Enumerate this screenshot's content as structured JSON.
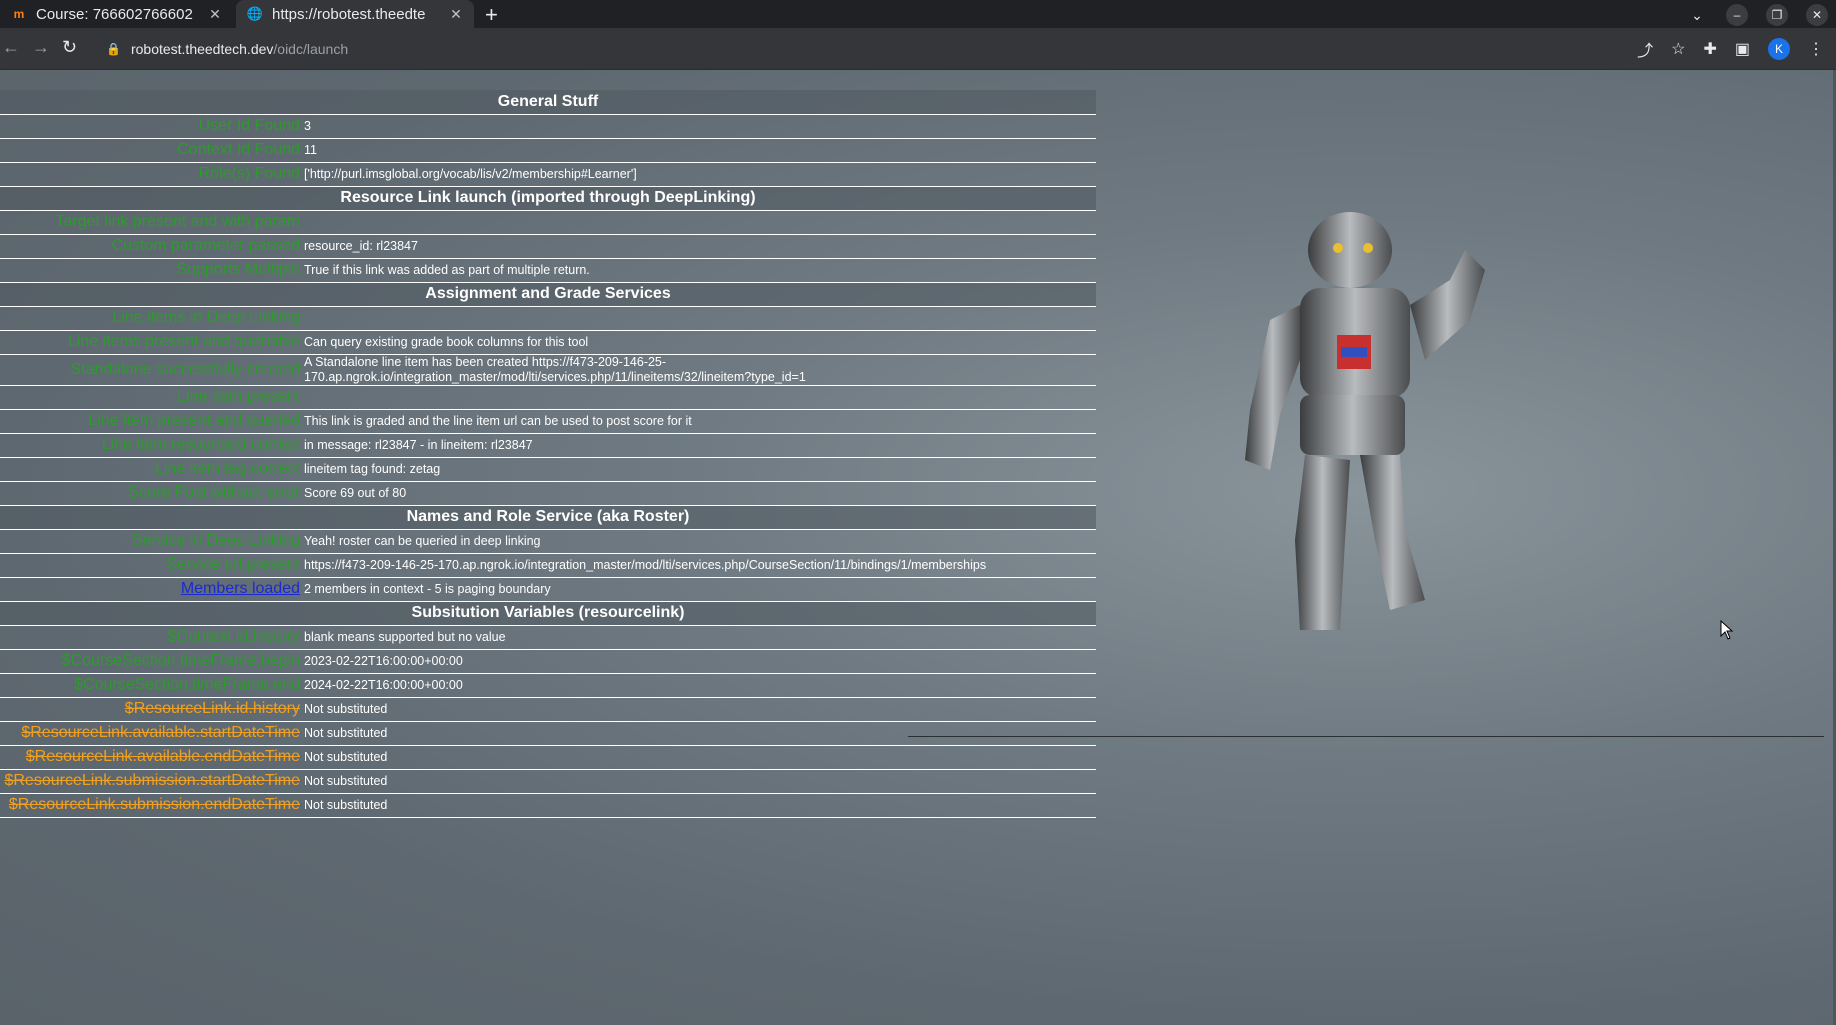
{
  "browser": {
    "tabs": [
      {
        "title": "Course: 766602766602",
        "favicon": "moodle-icon",
        "active": false
      },
      {
        "title": "https://robotest.theedte",
        "favicon": "globe-icon",
        "active": true
      }
    ],
    "profile_initial": "K",
    "url_host": "robotest.theedtech.dev",
    "url_path": "/oidc/launch"
  },
  "rows": [
    {
      "type": "section",
      "title": "General Stuff"
    },
    {
      "type": "row",
      "label": "User Id Found",
      "value": "3"
    },
    {
      "type": "row",
      "label": "Context Id Found",
      "value": "11"
    },
    {
      "type": "row",
      "label": "Role(s) Found",
      "value": "['http://purl.imsglobal.org/vocab/lis/v2/membership#Learner']"
    },
    {
      "type": "section",
      "title": "Resource Link launch (imported through DeepLinking)"
    },
    {
      "type": "row",
      "label": "Target link present and with param",
      "value": ""
    },
    {
      "type": "row",
      "label": "Custom parameter passed",
      "value": "resource_id: rl23847"
    },
    {
      "type": "row",
      "label": "Supports Multiple",
      "value": "True if this link was added as part of multiple return."
    },
    {
      "type": "section",
      "title": "Assignment and Grade Services"
    },
    {
      "type": "row",
      "label": "Line items in Deep Linking",
      "value": ""
    },
    {
      "type": "row",
      "label": "Line items present and queriable",
      "value": "Can query existing grade book columns for this tool"
    },
    {
      "type": "row",
      "label": "Standalone successfully created",
      "value": "A Standalone line item has been created https://f473-209-146-25-170.ap.ngrok.io/integration_master/mod/lti/services.php/11/lineitems/32/lineitem?type_id=1"
    },
    {
      "type": "row",
      "label": "Line item present",
      "value": ""
    },
    {
      "type": "row",
      "label": "Line item present and queried",
      "value": "This link is graded and the line item url can be used to post score for it"
    },
    {
      "type": "row",
      "label": "Line item resourceId correct",
      "value": "in message: rl23847 - in lineitem: rl23847"
    },
    {
      "type": "row",
      "label": "Line item tag correct",
      "value": "lineitem tag found: zetag"
    },
    {
      "type": "row",
      "label": "Score Post without error",
      "value": "Score 69 out of 80"
    },
    {
      "type": "section",
      "title": "Names and Role Service (aka Roster)"
    },
    {
      "type": "row",
      "label": "Service in Deep Linking",
      "value": "Yeah! roster can be queried in deep linking"
    },
    {
      "type": "row",
      "label": "Service url present",
      "value": "https://f473-209-146-25-170.ap.ngrok.io/integration_master/mod/lti/services.php/CourseSection/11/bindings/1/memberships"
    },
    {
      "type": "row",
      "label": "Members loaded",
      "value": "2 members in context - 5 is paging boundary",
      "link": true
    },
    {
      "type": "section",
      "title": "Subsitution Variables (resourcelink)"
    },
    {
      "type": "row",
      "label": "$Context.id.history",
      "value": "blank means supported but no value"
    },
    {
      "type": "row",
      "label": "$CourseSection.timeFrame.begin",
      "value": "2023-02-22T16:00:00+00:00"
    },
    {
      "type": "row",
      "label": "$CourseSection.timeFrame.end",
      "value": "2024-02-22T16:00:00+00:00"
    },
    {
      "type": "row",
      "label": "$ResourceLink.id.history",
      "value": "Not substituted",
      "warn": true
    },
    {
      "type": "row",
      "label": "$ResourceLink.available.startDateTime",
      "value": "Not substituted",
      "warn": true
    },
    {
      "type": "row",
      "label": "$ResourceLink.available.endDateTime",
      "value": "Not substituted",
      "warn": true
    },
    {
      "type": "row",
      "label": "$ResourceLink.submission.startDateTime",
      "value": "Not substituted",
      "warn": true
    },
    {
      "type": "row",
      "label": "$ResourceLink.submission.endDateTime",
      "value": "Not substituted",
      "warn": true
    }
  ]
}
